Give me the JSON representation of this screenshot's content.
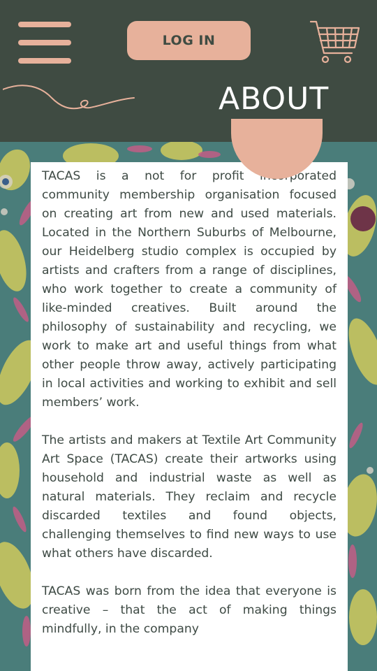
{
  "header": {
    "login_label": "LOG IN",
    "title": "ABOUT",
    "menu_icon": "hamburger-menu-icon",
    "cart_icon": "shopping-cart-icon"
  },
  "colors": {
    "header_bg": "#3f4b42",
    "accent": "#e7b19b",
    "text": "#3e4a44",
    "card_bg": "#ffffff"
  },
  "about": {
    "paragraphs": [
      "TACAS is a not for profit incorporated community membership organisation focused on creating art from new and used materials. Located in the Northern Suburbs of Melbourne, our Heidelberg studio complex is occupied by artists and crafters from a range of disciplines, who work together to create a community of like-minded creatives. Built around the philosophy of sustainability and recycling, we work to make art and useful things from what other people throw away, actively participating in local activities and working to exhibit and sell members’ work.",
      "The artists and makers at Textile Art Community Art Space (TACAS) create their artworks using household and industrial waste as well as natural materials. They reclaim and recycle discarded textiles and found objects, challenging themselves to find new ways to use what others have discarded.",
      "TACAS was born from the idea that everyone is creative – that the act of making things mindfully, in the company"
    ]
  }
}
